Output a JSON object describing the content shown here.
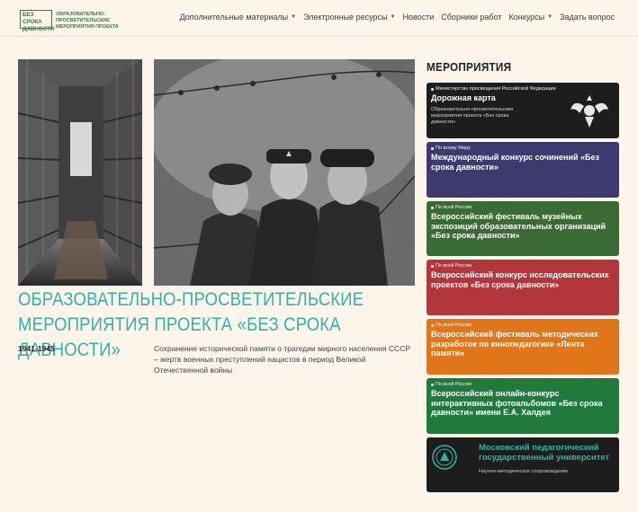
{
  "header": {
    "logo_text": "БЕЗ СРОКА ДАВНОСТИ",
    "logo_caption": "ОБРАЗОВАТЕЛЬНО-ПРОСВЕТИТЕЛЬСКИЕ МЕРОПРИЯТИЯ ПРОЕКТА",
    "nav": [
      {
        "label": "Дополнительные материалы",
        "dropdown": true
      },
      {
        "label": "Электронные ресурсы",
        "dropdown": true
      },
      {
        "label": "Новости",
        "dropdown": false
      },
      {
        "label": "Сборники работ",
        "dropdown": false
      },
      {
        "label": "Конкурсы",
        "dropdown": true
      },
      {
        "label": "Задать вопрос",
        "dropdown": false
      }
    ]
  },
  "main": {
    "title": "ОБРАЗОВАТЕЛЬНО-ПРОСВЕТИТЕЛЬСКИЕ МЕРОПРИЯТИЯ ПРОЕКТА «БЕЗ СРОКА ДАВНОСТИ»",
    "years": "1941-1945",
    "description": "Сохранение исторической памяти о трагедии мирного населения СССР – жертв военных преступлений нацистов в период Великой Отечественной войны"
  },
  "sidebar": {
    "title": "МЕРОПРИЯТИЯ",
    "cards": [
      {
        "tag": "Министерство просвещения Российской Федерации",
        "title": "Дорожная карта",
        "subtitle": "Образовательно-просветительские мероприятия проекта «Без срока давности»",
        "color": "#1d1d1d"
      },
      {
        "tag": "По всему Миру",
        "title": "Международный конкурс сочинений «Без срока давности»",
        "color": "#3c3a6e"
      },
      {
        "tag": "По всей России",
        "title": "Всероссийский фестиваль музейных экспозиций образовательных организаций «Без срока давности»",
        "color": "#3a6b34"
      },
      {
        "tag": "По всей России",
        "title": "Всероссийский конкурс исследовательских проектов «Без срока давности»",
        "color": "#b2363a"
      },
      {
        "tag": "По всей России",
        "title": "Всероссийский фестиваль методических разработок по кинопедагогике «Лента памяти»",
        "color": "#e07519"
      },
      {
        "tag": "По всей России",
        "title": "Всероссийский онлайн-конкурс интерактивных фотоальбомов «Без срока давности» имени Е.А. Халдея",
        "color": "#1f7a3c"
      },
      {
        "title": "Московский педагогический государственный университет",
        "subtitle": "Научно-методическое сопровождение",
        "color": "#1d1d1d"
      }
    ]
  },
  "colors": {
    "accent": "#35b1a6",
    "brand_green": "#3a7d44",
    "background": "#fdf4ea"
  }
}
